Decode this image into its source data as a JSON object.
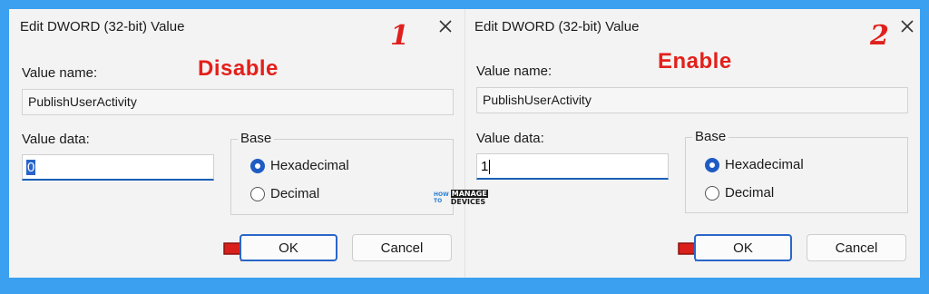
{
  "dialogs": [
    {
      "title": "Edit DWORD (32-bit) Value",
      "step_number": "1",
      "tag": "Disable",
      "value_name_label": "Value name:",
      "value_name": "PublishUserActivity",
      "value_data_label": "Value data:",
      "value_data": "0",
      "base_label": "Base",
      "hex_label": "Hexadecimal",
      "dec_label": "Decimal",
      "selected_base": "Hexadecimal",
      "ok_label": "OK",
      "cancel_label": "Cancel"
    },
    {
      "title": "Edit DWORD (32-bit) Value",
      "step_number": "2",
      "tag": "Enable",
      "value_name_label": "Value name:",
      "value_name": "PublishUserActivity",
      "value_data_label": "Value data:",
      "value_data": "1",
      "base_label": "Base",
      "hex_label": "Hexadecimal",
      "dec_label": "Decimal",
      "selected_base": "Hexadecimal",
      "ok_label": "OK",
      "cancel_label": "Cancel"
    }
  ],
  "logo": {
    "how": "HOW",
    "to": "TO",
    "manage": "MANAGE",
    "devices": "DEVICES"
  },
  "colors": {
    "background": "#3aa0ef",
    "annotation_red": "#e3201b",
    "accent_blue": "#1f5bc4"
  },
  "icons": {
    "close": "close-icon",
    "pointer": "red-arrow-icon"
  }
}
